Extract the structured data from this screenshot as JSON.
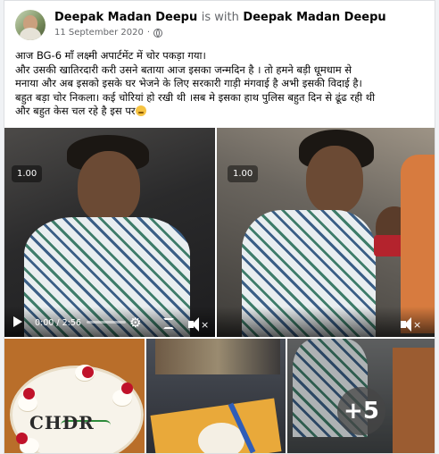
{
  "post": {
    "author": "Deepak Madan Deepu",
    "with_text": "is with",
    "tagged": "Deepak Madan Deepu",
    "date": "11 September 2020",
    "separator": "·",
    "caption_lines": [
      "आज BG-6 माँ लक्ष्मी अपार्टमेंट में चोर पकड़ा गया।",
      "और उसकी खातिरदारी करी उसने बताया आज इसका जन्मदिन है । तो हमने बड़ी धूमधाम से",
      "मनाया और अब इसको  इसके घर भेजने के लिए सरकारी गाड़ी मंगवाई है अभी इसकी विदाई है।",
      "बहुत बड़ा चोर निकला। कई चोरियां हो रखी थी ।सब मे इसका हाथ पुलिस बहुत दिन से ढूंढ रही थी",
      "और बहुत केस चल रहे है इस पर"
    ]
  },
  "videos": [
    {
      "badge": "1.00",
      "time": "0:00 / 2:56"
    },
    {
      "badge": "1.00"
    }
  ],
  "photos": {
    "cake_text": "CHDR",
    "more_count": "+5"
  },
  "icons": [
    "globe-icon",
    "play-icon",
    "gear-icon",
    "fullscreen-icon",
    "speaker-muted-icon",
    "emoji-icon"
  ]
}
